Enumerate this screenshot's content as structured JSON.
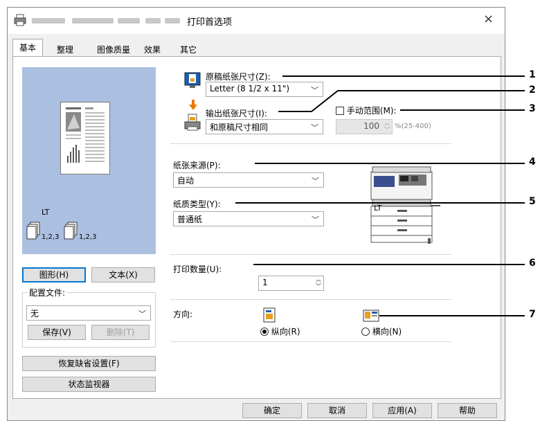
{
  "window": {
    "title": "打印首选项",
    "close_symbol": "×"
  },
  "tabs": [
    "基本",
    "整理",
    "图像质量",
    "效果",
    "其它"
  ],
  "preview": {
    "paper_code": "LT",
    "copies_label_1": "1,2,3",
    "copies_label_2": "1,2,3"
  },
  "view_buttons": {
    "graphic": "图形(H)",
    "text": "文本(X)"
  },
  "profile": {
    "label": "配置文件:",
    "value": "无",
    "save": "保存(V)",
    "delete": "删除(T)"
  },
  "restore_defaults": "恢复缺省设置(F)",
  "status_monitor": "状态监视器",
  "paper": {
    "original_size_label": "原稿纸张尺寸(Z):",
    "original_size_value": "Letter (8 1/2 x 11\")",
    "output_size_label": "输出纸张尺寸(I):",
    "output_size_value": "和原稿尺寸相同",
    "manual_range_label": "手动范围(M):",
    "zoom_value": "100",
    "zoom_range": "%(25-400)"
  },
  "source": {
    "label": "纸张来源(P):",
    "value": "自动"
  },
  "type": {
    "label": "纸质类型(Y):",
    "value": "普通纸"
  },
  "printer_paper_code": "LT",
  "copies": {
    "label": "打印数量(U):",
    "value": "1"
  },
  "orientation": {
    "label": "方向:",
    "portrait": "纵向(R)",
    "landscape": "横向(N)"
  },
  "footer": {
    "ok": "确定",
    "cancel": "取消",
    "apply": "应用(A)",
    "help": "帮助"
  },
  "callouts": [
    "1",
    "2",
    "3",
    "4",
    "5",
    "6",
    "7"
  ],
  "colors": {
    "preview_bg": "#abc0e0",
    "focus": "#0078d7",
    "panel_bg": "#ffffff",
    "dialog_bg": "#f0f0f0"
  }
}
